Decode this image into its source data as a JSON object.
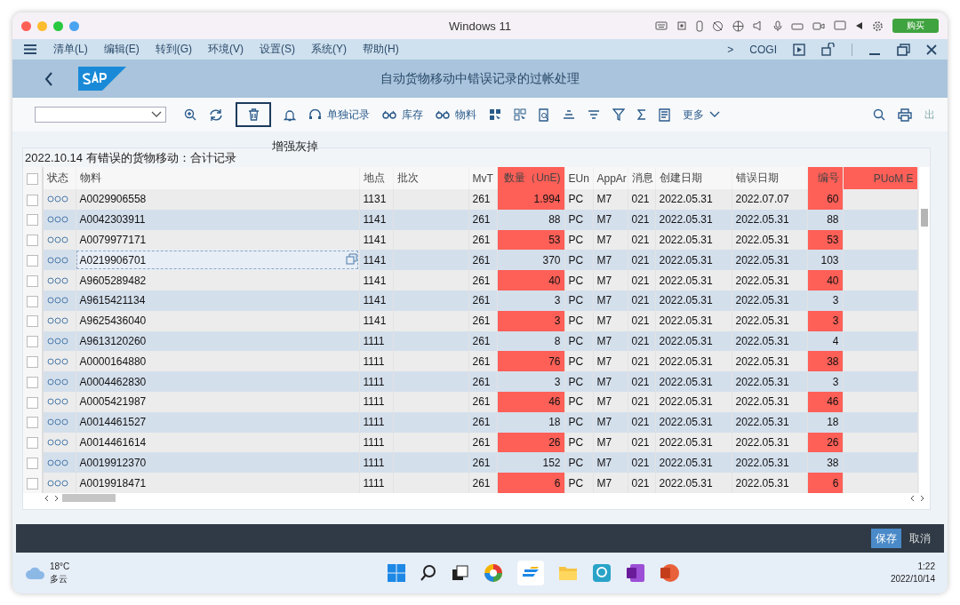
{
  "window": {
    "title": "Windows 11",
    "buy_button": "购买"
  },
  "menu": {
    "items": [
      "清单(L)",
      "编辑(E)",
      "转到(G)",
      "环境(V)",
      "设置(S)",
      "系统(Y)",
      "帮助(H)"
    ],
    "chevron": ">",
    "transaction": "COGI"
  },
  "header": {
    "title": "自动货物移动中错误记录的过帐处理"
  },
  "toolbar": {
    "delete_focused": true,
    "labels": [
      "单独记录",
      "库存",
      "物料"
    ],
    "more": "更多",
    "exit": "出"
  },
  "tooltip": "增强灰掉",
  "table": {
    "select_all_checked": false,
    "title": "2022.10.14 有错误的货物移动：合计记录",
    "columns": [
      "状态",
      "物料",
      "地点",
      "批次",
      "MvT",
      "数量（UnE)",
      "EUn",
      "AppAr",
      "消息",
      "创建日期",
      "错误日期",
      "编号",
      "PUoM E"
    ],
    "rows": [
      {
        "material": "A0029906558",
        "plant": "1131",
        "mvt": "261",
        "qty": "1.994",
        "eun": "PC",
        "appar": "M7",
        "msg": "021",
        "created": "2022.05.31",
        "error_date": "2022.07.07",
        "number": "60",
        "checked": false,
        "focused": false
      },
      {
        "material": "A0042303911",
        "plant": "1141",
        "mvt": "261",
        "qty": "88",
        "eun": "PC",
        "appar": "M7",
        "msg": "021",
        "created": "2022.05.31",
        "error_date": "2022.05.31",
        "number": "88",
        "checked": false,
        "focused": false
      },
      {
        "material": "A0079977171",
        "plant": "1141",
        "mvt": "261",
        "qty": "53",
        "eun": "PC",
        "appar": "M7",
        "msg": "021",
        "created": "2022.05.31",
        "error_date": "2022.05.31",
        "number": "53",
        "checked": false,
        "focused": false
      },
      {
        "material": "A0219906701",
        "plant": "1141",
        "mvt": "261",
        "qty": "370",
        "eun": "PC",
        "appar": "M7",
        "msg": "021",
        "created": "2022.05.31",
        "error_date": "2022.05.31",
        "number": "103",
        "checked": false,
        "focused": true
      },
      {
        "material": "A9605289482",
        "plant": "1141",
        "mvt": "261",
        "qty": "40",
        "eun": "PC",
        "appar": "M7",
        "msg": "021",
        "created": "2022.05.31",
        "error_date": "2022.05.31",
        "number": "40",
        "checked": false,
        "focused": false
      },
      {
        "material": "A9615421134",
        "plant": "1141",
        "mvt": "261",
        "qty": "3",
        "eun": "PC",
        "appar": "M7",
        "msg": "021",
        "created": "2022.05.31",
        "error_date": "2022.05.31",
        "number": "3",
        "checked": false,
        "focused": false
      },
      {
        "material": "A9625436040",
        "plant": "1141",
        "mvt": "261",
        "qty": "3",
        "eun": "PC",
        "appar": "M7",
        "msg": "021",
        "created": "2022.05.31",
        "error_date": "2022.05.31",
        "number": "3",
        "checked": false,
        "focused": false
      },
      {
        "material": "A9613120260",
        "plant": "1111",
        "mvt": "261",
        "qty": "8",
        "eun": "PC",
        "appar": "M7",
        "msg": "021",
        "created": "2022.05.31",
        "error_date": "2022.05.31",
        "number": "4",
        "checked": false,
        "focused": false
      },
      {
        "material": "A0000164880",
        "plant": "1111",
        "mvt": "261",
        "qty": "76",
        "eun": "PC",
        "appar": "M7",
        "msg": "021",
        "created": "2022.05.31",
        "error_date": "2022.05.31",
        "number": "38",
        "checked": false,
        "focused": false
      },
      {
        "material": "A0004462830",
        "plant": "1111",
        "mvt": "261",
        "qty": "3",
        "eun": "PC",
        "appar": "M7",
        "msg": "021",
        "created": "2022.05.31",
        "error_date": "2022.05.31",
        "number": "3",
        "checked": false,
        "focused": false
      },
      {
        "material": "A0005421987",
        "plant": "1111",
        "mvt": "261",
        "qty": "46",
        "eun": "PC",
        "appar": "M7",
        "msg": "021",
        "created": "2022.05.31",
        "error_date": "2022.05.31",
        "number": "46",
        "checked": false,
        "focused": false
      },
      {
        "material": "A0014461527",
        "plant": "1111",
        "mvt": "261",
        "qty": "18",
        "eun": "PC",
        "appar": "M7",
        "msg": "021",
        "created": "2022.05.31",
        "error_date": "2022.05.31",
        "number": "18",
        "checked": false,
        "focused": false
      },
      {
        "material": "A0014461614",
        "plant": "1111",
        "mvt": "261",
        "qty": "26",
        "eun": "PC",
        "appar": "M7",
        "msg": "021",
        "created": "2022.05.31",
        "error_date": "2022.05.31",
        "number": "26",
        "checked": false,
        "focused": false
      },
      {
        "material": "A0019912370",
        "plant": "1111",
        "mvt": "261",
        "qty": "152",
        "eun": "PC",
        "appar": "M7",
        "msg": "021",
        "created": "2022.05.31",
        "error_date": "2022.05.31",
        "number": "38",
        "checked": false,
        "focused": false
      },
      {
        "material": "A0019918471",
        "plant": "1111",
        "mvt": "261",
        "qty": "6",
        "eun": "PC",
        "appar": "M7",
        "msg": "021",
        "created": "2022.05.31",
        "error_date": "2022.05.31",
        "number": "6",
        "checked": false,
        "focused": false
      }
    ]
  },
  "footer": {
    "buttons": [
      {
        "label": "保存",
        "selected": true
      },
      {
        "label": "取消",
        "selected": false
      }
    ]
  },
  "taskbar": {
    "temperature": "18°C",
    "weather": "多云",
    "time": "1:22",
    "date": "2022/10/14"
  }
}
